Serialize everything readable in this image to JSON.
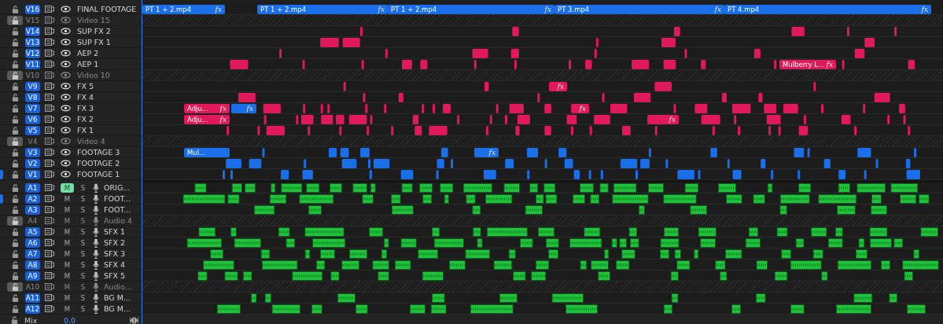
{
  "video_tracks": [
    {
      "id": "V16",
      "name": "FINAL FOOTAGE",
      "locked": false,
      "patched": false,
      "clips": [
        {
          "label": "PT 1 + 2.mp4",
          "fx": "fx",
          "color": "#1a6ee8"
        },
        {
          "label": "PT 1 + 2.mp4",
          "fx": "fx",
          "color": "#1a6ee8"
        },
        {
          "label": "PT 1 + 2.mp4",
          "fx": "fx",
          "color": "#1a6ee8"
        },
        {
          "label": "PT 3.mp4",
          "fx": "fx",
          "color": "#1a6ee8"
        },
        {
          "label": "PT 4.mp4",
          "fx": "fx",
          "color": "#1a6ee8"
        }
      ]
    },
    {
      "id": "V15",
      "name": "Video 15",
      "locked": true,
      "patched": false
    },
    {
      "id": "V14",
      "name": "SUP FX 2",
      "locked": false,
      "patched": false,
      "color": "#e0195a"
    },
    {
      "id": "V13",
      "name": "SUP FX 1",
      "locked": false,
      "patched": false,
      "color": "#e0195a"
    },
    {
      "id": "V12",
      "name": "AEP 2",
      "locked": false,
      "patched": false,
      "color": "#e0195a"
    },
    {
      "id": "V11",
      "name": "AEP 1",
      "locked": false,
      "patched": false,
      "color": "#e0195a",
      "clips": [
        {
          "label": "Mulberry L...",
          "fx": "fx",
          "color": "#e0195a"
        }
      ]
    },
    {
      "id": "V10",
      "name": "Video 10",
      "locked": true,
      "patched": false
    },
    {
      "id": "V9",
      "name": "FX 5",
      "locked": false,
      "patched": false,
      "color": "#e0195a",
      "clips": [
        {
          "fx": "fx",
          "color": "#e0195a"
        }
      ]
    },
    {
      "id": "V8",
      "name": "FX 4",
      "locked": false,
      "patched": false,
      "color": "#e0195a"
    },
    {
      "id": "V7",
      "name": "FX 3",
      "locked": false,
      "patched": false,
      "color": "#e0195a",
      "clips": [
        {
          "label": "Adju...",
          "fx": "fx",
          "color": "#e0195a"
        },
        {
          "fx": "fx",
          "color": "#1a6ee8"
        },
        {
          "fx": "fx",
          "color": "#e0195a"
        }
      ]
    },
    {
      "id": "V6",
      "name": "FX 2",
      "locked": false,
      "patched": false,
      "color": "#e0195a",
      "clips": [
        {
          "label": "Adju...",
          "fx": "fx",
          "color": "#e0195a"
        },
        {
          "fx": "fx",
          "color": "#e0195a"
        }
      ]
    },
    {
      "id": "V5",
      "name": "FX 1",
      "locked": false,
      "patched": false,
      "color": "#e0195a"
    },
    {
      "id": "V4",
      "name": "Video 4",
      "locked": true,
      "patched": false
    },
    {
      "id": "V3",
      "name": "FOOTAGE 3",
      "locked": false,
      "patched": false,
      "color": "#1a6ee8",
      "clips": [
        {
          "label": "Mul...",
          "color": "#1a6ee8"
        },
        {
          "fx": "fx",
          "color": "#1a6ee8"
        }
      ]
    },
    {
      "id": "V2",
      "name": "FOOTAGE 2",
      "locked": false,
      "patched": false,
      "color": "#1a6ee8"
    },
    {
      "id": "V1",
      "name": "FOOTAGE 1",
      "locked": false,
      "patched": true,
      "color": "#1a6ee8"
    }
  ],
  "audio_tracks": [
    {
      "id": "A1",
      "name": "ORIG...",
      "locked": false,
      "patched": false,
      "muted": true,
      "soloed": false,
      "mute_label": "M",
      "solo_label": "S"
    },
    {
      "id": "A2",
      "name": "FOOT...",
      "locked": false,
      "patched": true,
      "muted": false,
      "soloed": false,
      "mute_label": "M",
      "solo_label": "S"
    },
    {
      "id": "A3",
      "name": "FOOT...",
      "locked": false,
      "patched": false,
      "muted": false,
      "soloed": false,
      "mute_label": "M",
      "solo_label": "S"
    },
    {
      "id": "A4",
      "name": "Audio 4",
      "locked": true,
      "patched": false,
      "muted": false,
      "soloed": false,
      "mute_label": "M",
      "solo_label": "S"
    },
    {
      "id": "A5",
      "name": "SFX 1",
      "locked": false,
      "patched": false,
      "muted": false,
      "soloed": false,
      "mute_label": "M",
      "solo_label": "S"
    },
    {
      "id": "A6",
      "name": "SFX 2",
      "locked": false,
      "patched": false,
      "muted": false,
      "soloed": false,
      "mute_label": "M",
      "solo_label": "S"
    },
    {
      "id": "A7",
      "name": "SFX 3",
      "locked": false,
      "patched": false,
      "muted": false,
      "soloed": false,
      "mute_label": "M",
      "solo_label": "S"
    },
    {
      "id": "A8",
      "name": "SFX 4",
      "locked": false,
      "patched": false,
      "muted": false,
      "soloed": false,
      "mute_label": "M",
      "solo_label": "S"
    },
    {
      "id": "A9",
      "name": "SFX 5",
      "locked": false,
      "patched": false,
      "muted": false,
      "soloed": false,
      "mute_label": "M",
      "solo_label": "S"
    },
    {
      "id": "A10",
      "name": "Audio...",
      "locked": true,
      "patched": false,
      "muted": false,
      "soloed": false,
      "mute_label": "M",
      "solo_label": "S"
    },
    {
      "id": "A11",
      "name": "BG M...",
      "locked": false,
      "patched": false,
      "muted": false,
      "soloed": false,
      "mute_label": "M",
      "solo_label": "S"
    },
    {
      "id": "A12",
      "name": "BG M...",
      "locked": false,
      "patched": false,
      "muted": false,
      "soloed": false,
      "mute_label": "M",
      "solo_label": "S"
    }
  ],
  "mix": {
    "label": "Mix",
    "value": "0,0"
  }
}
